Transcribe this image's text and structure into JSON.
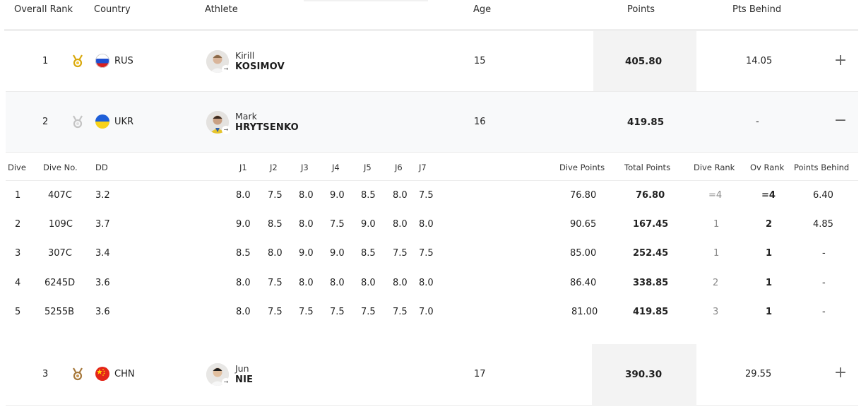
{
  "header": {
    "overall_rank": "Overall Rank",
    "country": "Country",
    "athlete": "Athlete",
    "age": "Age",
    "points": "Points",
    "pts_behind": "Pts Behind"
  },
  "rows": [
    {
      "rank": "1",
      "medal": "gold-medal-icon",
      "country": "RUS",
      "first": "Kirill",
      "last": "KOSIMOV",
      "age": "15",
      "points": "405.80",
      "pts_behind": "14.05",
      "toggle": "+"
    },
    {
      "rank": "2",
      "medal": "silver-medal-icon",
      "country": "UKR",
      "first": "Mark",
      "last": "HRYTSENKO",
      "age": "16",
      "points": "419.85",
      "pts_behind": "-",
      "toggle": "−"
    },
    {
      "rank": "3",
      "medal": "bronze-medal-icon",
      "country": "CHN",
      "first": "Jun",
      "last": "NIE",
      "age": "17",
      "points": "390.30",
      "pts_behind": "29.55",
      "toggle": "+"
    }
  ],
  "dives": {
    "headers": {
      "dive": "Dive",
      "dive_no": "Dive No.",
      "dd": "DD",
      "j1": "J1",
      "j2": "J2",
      "j3": "J3",
      "j4": "J4",
      "j5": "J5",
      "j6": "J6",
      "j7": "J7",
      "dive_points": "Dive Points",
      "total_points": "Total Points",
      "dive_rank": "Dive Rank",
      "ov_rank": "Ov Rank",
      "points_behind": "Points Behind"
    },
    "rows": [
      {
        "dive": "1",
        "no": "407C",
        "dd": "3.2",
        "j": [
          "8.0",
          "7.5",
          "8.0",
          "9.0",
          "8.5",
          "8.0",
          "7.5"
        ],
        "dive_points": "76.80",
        "total": "76.80",
        "dive_rank": "=4",
        "ov_rank": "=4",
        "behind": "6.40"
      },
      {
        "dive": "2",
        "no": "109C",
        "dd": "3.7",
        "j": [
          "9.0",
          "8.5",
          "8.0",
          "7.5",
          "9.0",
          "8.0",
          "8.0"
        ],
        "dive_points": "90.65",
        "total": "167.45",
        "dive_rank": "1",
        "ov_rank": "2",
        "behind": "4.85"
      },
      {
        "dive": "3",
        "no": "307C",
        "dd": "3.4",
        "j": [
          "8.5",
          "8.0",
          "9.0",
          "9.0",
          "8.5",
          "7.5",
          "7.5"
        ],
        "dive_points": "85.00",
        "total": "252.45",
        "dive_rank": "1",
        "ov_rank": "1",
        "behind": "-"
      },
      {
        "dive": "4",
        "no": "6245D",
        "dd": "3.6",
        "j": [
          "8.0",
          "7.5",
          "8.0",
          "8.0",
          "8.0",
          "8.0",
          "8.0"
        ],
        "dive_points": "86.40",
        "total": "338.85",
        "dive_rank": "2",
        "ov_rank": "1",
        "behind": "-"
      },
      {
        "dive": "5",
        "no": "5255B",
        "dd": "3.6",
        "j": [
          "8.0",
          "7.5",
          "7.5",
          "7.5",
          "7.5",
          "7.5",
          "7.0"
        ],
        "dive_points": "81.00",
        "total": "419.85",
        "dive_rank": "3",
        "ov_rank": "1",
        "behind": "-"
      }
    ]
  }
}
